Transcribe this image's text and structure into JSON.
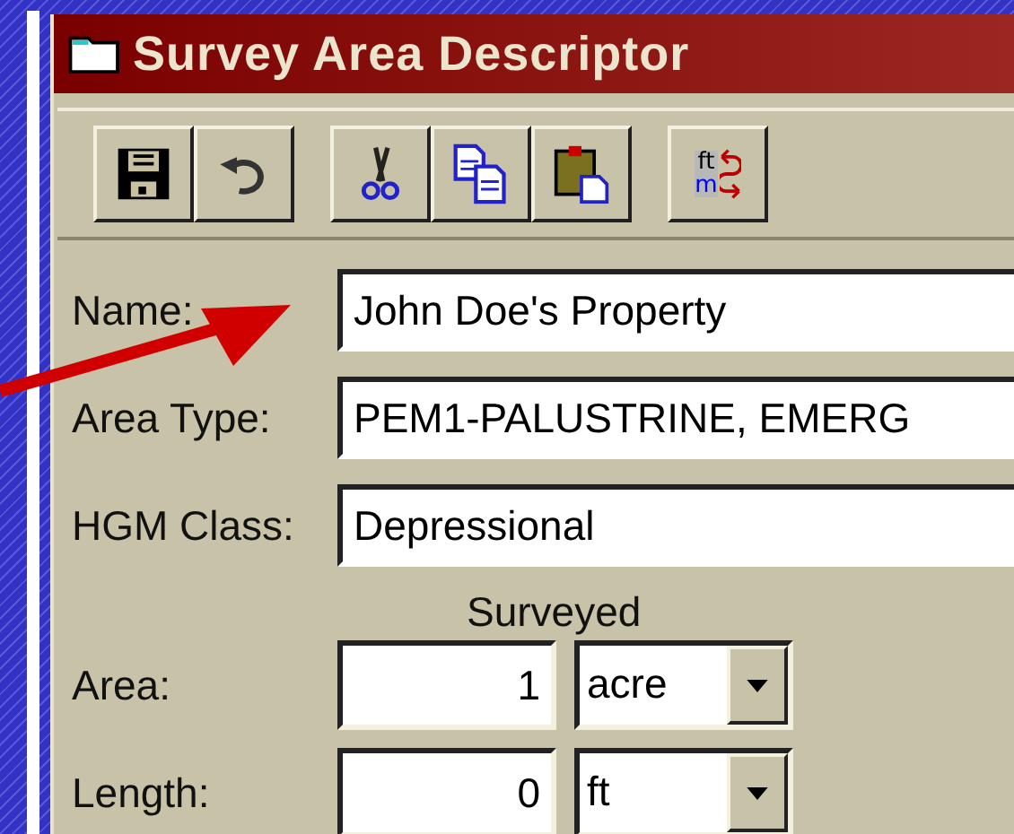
{
  "window": {
    "title": "Survey Area Descriptor"
  },
  "unit_toggle": {
    "top": "ft",
    "bottom": "m"
  },
  "fields": [
    {
      "label": "Name:",
      "value": "John Doe's Property"
    },
    {
      "label": "Area Type:",
      "value": "PEM1-PALUSTRINE, EMERG"
    },
    {
      "label": "HGM Class:",
      "value": "Depressional"
    }
  ],
  "measurements": {
    "heading": "Surveyed",
    "rows": [
      {
        "label": "Area:",
        "value": "1",
        "unit": "acre"
      },
      {
        "label": "Length:",
        "value": "0",
        "unit": "ft"
      }
    ]
  }
}
